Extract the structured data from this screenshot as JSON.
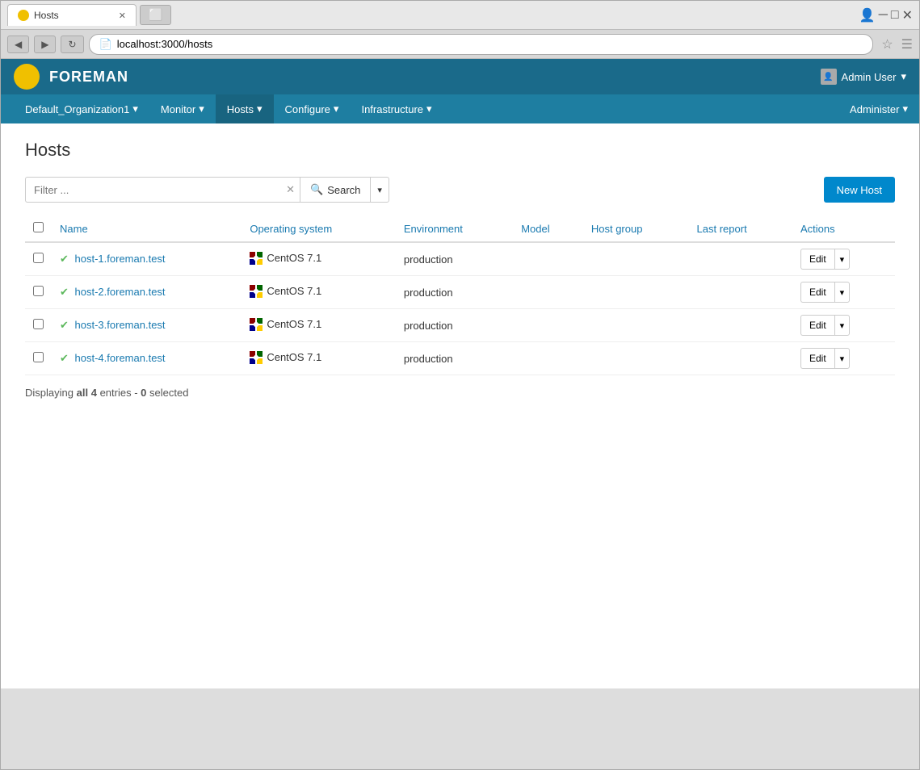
{
  "browser": {
    "tab_title": "Hosts",
    "url": "localhost:3000/hosts",
    "new_tab_icon": "+"
  },
  "topnav": {
    "brand": "FOREMAN",
    "user": "Admin User",
    "user_caret": "▾"
  },
  "mainnav": {
    "items": [
      {
        "label": "Default_Organization1",
        "caret": "▾",
        "active": false
      },
      {
        "label": "Monitor",
        "caret": "▾",
        "active": false
      },
      {
        "label": "Hosts",
        "caret": "▾",
        "active": true
      },
      {
        "label": "Configure",
        "caret": "▾",
        "active": false
      },
      {
        "label": "Infrastructure",
        "caret": "▾",
        "active": false
      },
      {
        "label": "Administer",
        "caret": "▾",
        "active": false
      }
    ]
  },
  "page": {
    "title": "Hosts",
    "filter_placeholder": "Filter ...",
    "search_label": "Search",
    "new_host_label": "New Host"
  },
  "table": {
    "columns": [
      "Name",
      "Operating system",
      "Environment",
      "Model",
      "Host group",
      "Last report",
      "Actions"
    ],
    "rows": [
      {
        "name": "host-1.foreman.test",
        "os": "CentOS 7.1",
        "environment": "production",
        "model": "",
        "host_group": "",
        "last_report": "",
        "edit_label": "Edit"
      },
      {
        "name": "host-2.foreman.test",
        "os": "CentOS 7.1",
        "environment": "production",
        "model": "",
        "host_group": "",
        "last_report": "",
        "edit_label": "Edit"
      },
      {
        "name": "host-3.foreman.test",
        "os": "CentOS 7.1",
        "environment": "production",
        "model": "",
        "host_group": "",
        "last_report": "",
        "edit_label": "Edit"
      },
      {
        "name": "host-4.foreman.test",
        "os": "CentOS 7.1",
        "environment": "production",
        "model": "",
        "host_group": "",
        "last_report": "",
        "edit_label": "Edit"
      }
    ]
  },
  "status": {
    "prefix": "Displaying",
    "qualifier": "all",
    "count": "4",
    "entries_text": "entries -",
    "selected_count": "0",
    "selected_text": "selected"
  }
}
